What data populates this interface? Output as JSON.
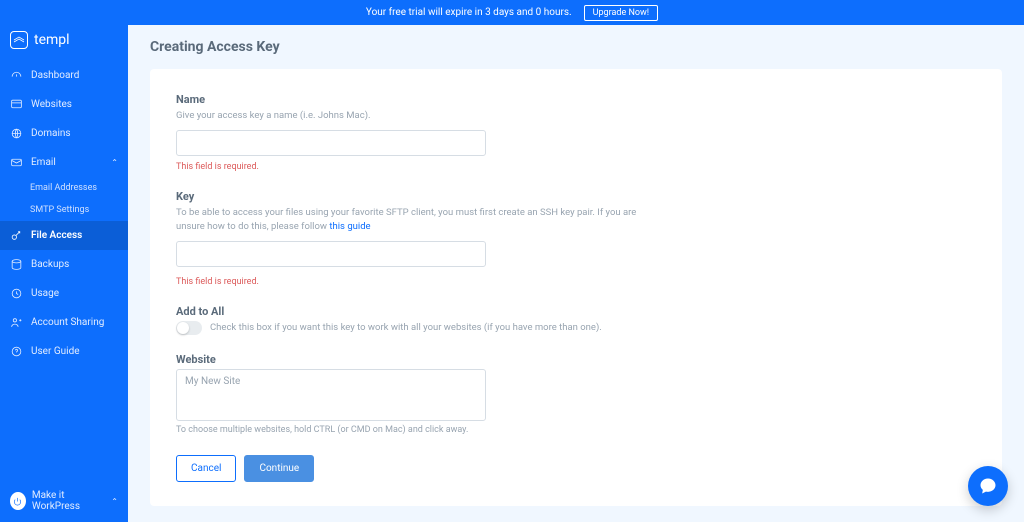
{
  "banner": {
    "message": "Your free trial will expire in 3 days and 0 hours.",
    "cta": "Upgrade Now!"
  },
  "brand": "templ",
  "sidebar": {
    "items": [
      {
        "label": "Dashboard"
      },
      {
        "label": "Websites"
      },
      {
        "label": "Domains"
      },
      {
        "label": "Email"
      },
      {
        "label": "File Access"
      },
      {
        "label": "Backups"
      },
      {
        "label": "Usage"
      },
      {
        "label": "Account Sharing"
      },
      {
        "label": "User Guide"
      }
    ],
    "email_sub": [
      {
        "label": "Email Addresses"
      },
      {
        "label": "SMTP Settings"
      }
    ],
    "footer": "Make it WorkPress"
  },
  "page": {
    "title": "Creating Access Key",
    "name": {
      "label": "Name",
      "help": "Give your access key a name (i.e. Johns Mac).",
      "value": "",
      "error": "This field is required."
    },
    "key": {
      "label": "Key",
      "help_prefix": "To be able to access your files using your favorite SFTP client, you must first create an SSH key pair. If you are unsure how to do this, please follow ",
      "help_link": "this guide",
      "value": "",
      "error": "This field is required."
    },
    "add_all": {
      "label": "Add to All",
      "desc": "Check this box if you want this key to work with all your websites (if you have more than one)."
    },
    "website": {
      "label": "Website",
      "options": [
        "My New Site"
      ],
      "hint": "To choose multiple websites, hold CTRL (or CMD on Mac) and click away."
    },
    "actions": {
      "cancel": "Cancel",
      "continue": "Continue"
    }
  }
}
